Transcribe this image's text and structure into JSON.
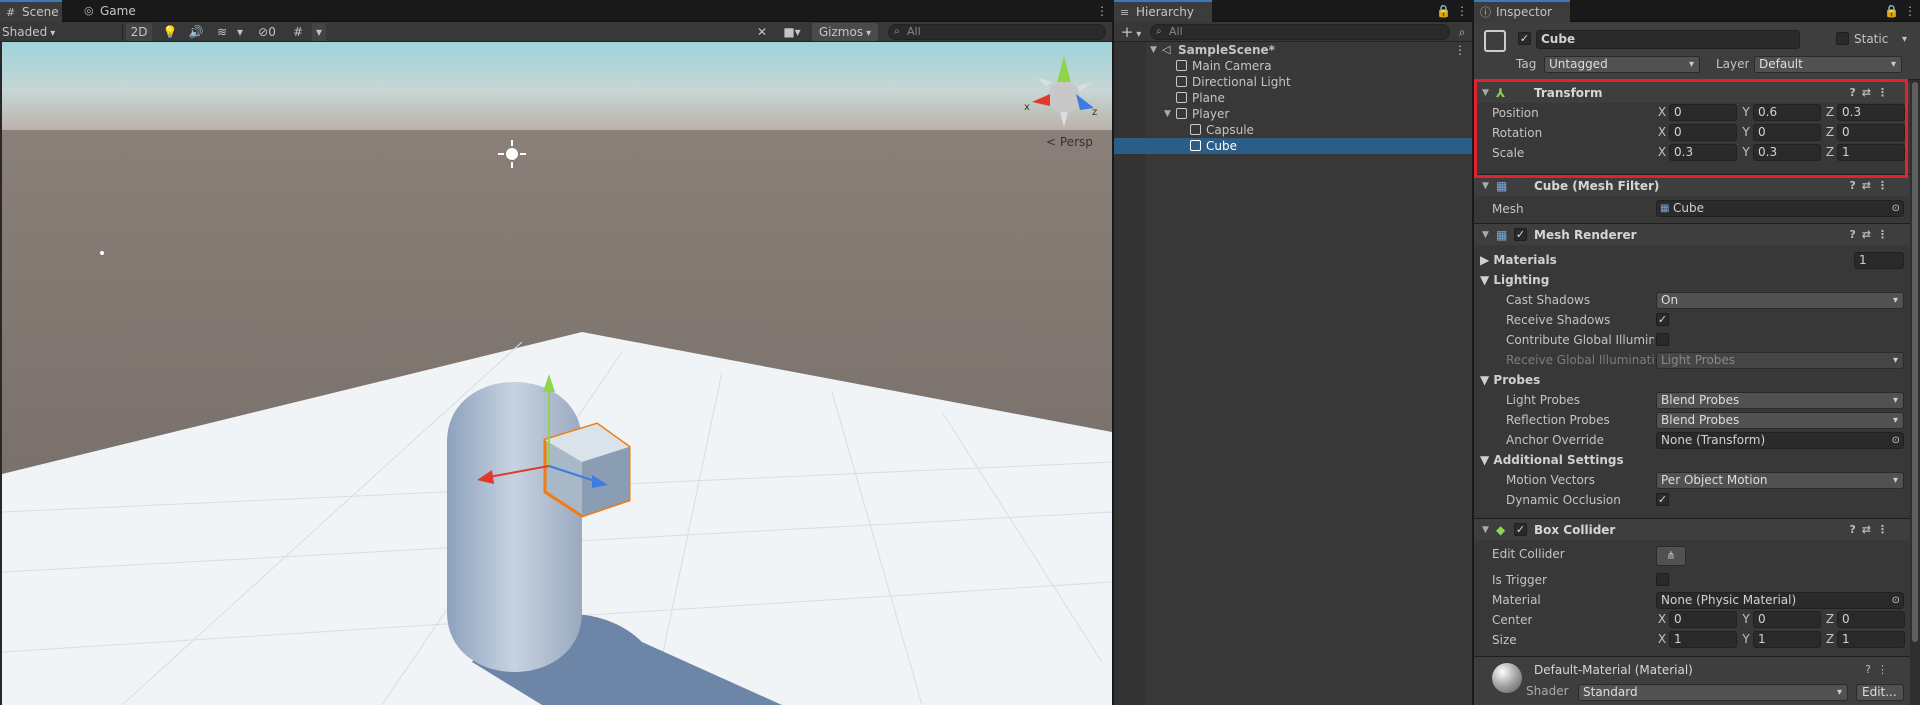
{
  "scene_panel": {
    "tabs": [
      {
        "label": "Scene",
        "active": true
      },
      {
        "label": "Game",
        "active": false
      }
    ],
    "toolbar": {
      "shading_mode": "Shaded",
      "mode_2d": "2D",
      "hidden_count": "0",
      "gizmos_label": "Gizmos",
      "search_placeholder": "All"
    },
    "persp_label": "Persp",
    "axis_labels": {
      "x": "x",
      "z": "z"
    }
  },
  "hierarchy": {
    "tab_label": "Hierarchy",
    "search_placeholder": "All",
    "add_label": "+",
    "items": [
      {
        "label": "SampleScene*",
        "level": 0,
        "foldout": "expanded",
        "is_scene": true
      },
      {
        "label": "Main Camera",
        "level": 1
      },
      {
        "label": "Directional Light",
        "level": 1
      },
      {
        "label": "Plane",
        "level": 1
      },
      {
        "label": "Player",
        "level": 1,
        "foldout": "expanded"
      },
      {
        "label": "Capsule",
        "level": 2
      },
      {
        "label": "Cube",
        "level": 2,
        "selected": true
      }
    ]
  },
  "inspector": {
    "tab_label": "Inspector",
    "object_name": "Cube",
    "static_label": "Static",
    "tag_label": "Tag",
    "tag_value": "Untagged",
    "layer_label": "Layer",
    "layer_value": "Default",
    "transform": {
      "title": "Transform",
      "rows": [
        {
          "label": "Position",
          "x": "0",
          "y": "0.6",
          "z": "0.3"
        },
        {
          "label": "Rotation",
          "x": "0",
          "y": "0",
          "z": "0"
        },
        {
          "label": "Scale",
          "x": "0.3",
          "y": "0.3",
          "z": "1"
        }
      ]
    },
    "mesh_filter": {
      "title": "Cube (Mesh Filter)",
      "mesh_label": "Mesh",
      "mesh_value": "Cube"
    },
    "mesh_renderer": {
      "title": "Mesh Renderer",
      "materials_label": "Materials",
      "materials_count": "1",
      "lighting_label": "Lighting",
      "cast_shadows_label": "Cast Shadows",
      "cast_shadows_value": "On",
      "receive_shadows_label": "Receive Shadows",
      "contribute_gi_label": "Contribute Global Illumina",
      "receive_gi_label": "Receive Global Illuminatio",
      "receive_gi_value": "Light Probes",
      "probes_label": "Probes",
      "light_probes_label": "Light Probes",
      "light_probes_value": "Blend Probes",
      "reflection_probes_label": "Reflection Probes",
      "reflection_probes_value": "Blend Probes",
      "anchor_override_label": "Anchor Override",
      "anchor_override_value": "None (Transform)",
      "additional_settings_label": "Additional Settings",
      "motion_vectors_label": "Motion Vectors",
      "motion_vectors_value": "Per Object Motion",
      "dynamic_occlusion_label": "Dynamic Occlusion"
    },
    "box_collider": {
      "title": "Box Collider",
      "edit_collider_label": "Edit Collider",
      "is_trigger_label": "Is Trigger",
      "material_label": "Material",
      "material_value": "None (Physic Material)",
      "center_label": "Center",
      "center": {
        "x": "0",
        "y": "0",
        "z": "0"
      },
      "size_label": "Size",
      "size": {
        "x": "1",
        "y": "1",
        "z": "1"
      }
    },
    "material": {
      "title": "Default-Material (Material)",
      "shader_label": "Shader",
      "shader_value": "Standard",
      "edit_label": "Edit..."
    },
    "axis": {
      "x": "X",
      "y": "Y",
      "z": "Z"
    }
  },
  "colors": {
    "highlight_box": "#e0232e",
    "selection": "#2c5d87",
    "accent_tab": "#3a79bb"
  }
}
